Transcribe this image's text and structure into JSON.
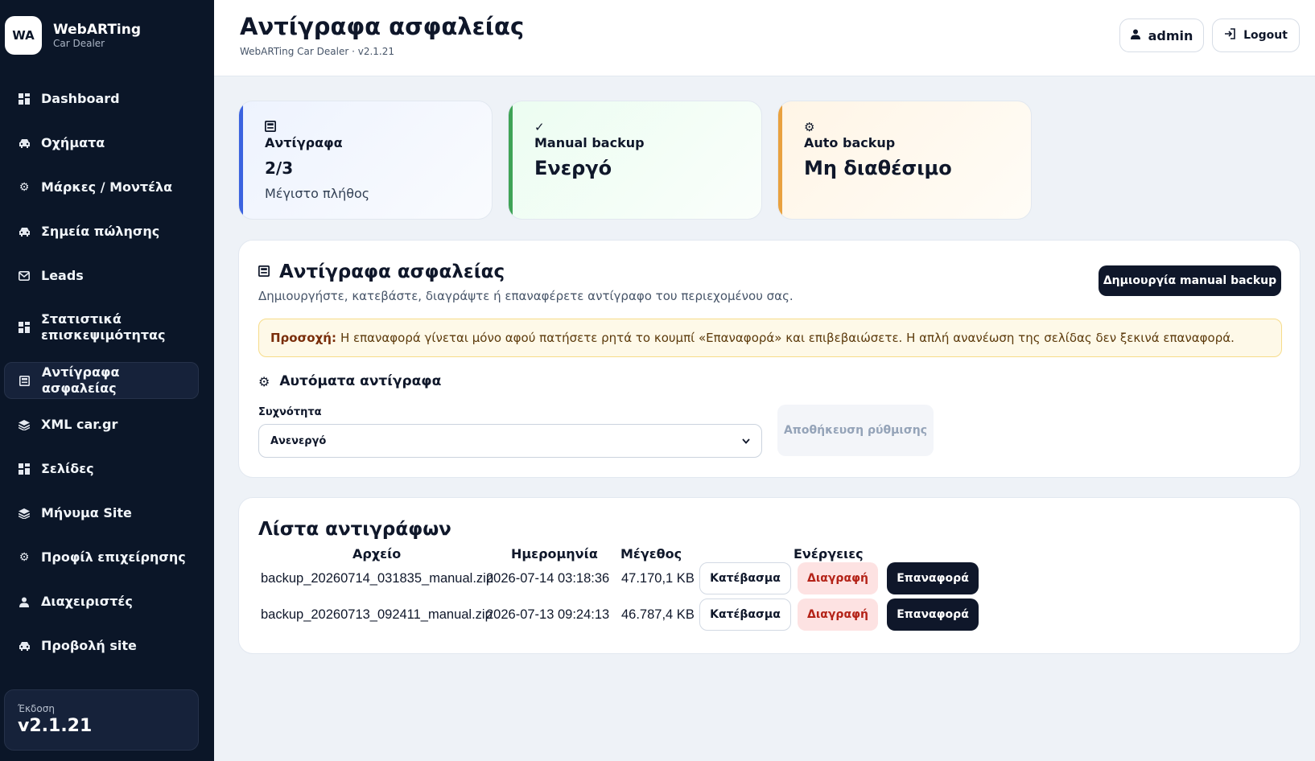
{
  "brand": {
    "logo": "WA",
    "name": "WebARTing",
    "subtitle": "Car Dealer"
  },
  "sidebar": {
    "items": [
      {
        "label": "Dashboard",
        "icon": "grid-icon"
      },
      {
        "label": "Οχήματα",
        "icon": "car-icon"
      },
      {
        "label": "Μάρκες / Μοντέλα",
        "icon": "gear-icon"
      },
      {
        "label": "Σημεία πώλησης",
        "icon": "car-icon"
      },
      {
        "label": "Leads",
        "icon": "mail-icon"
      },
      {
        "label": "Στατιστικά επισκεψιμότητας",
        "icon": "grid-icon"
      },
      {
        "label": "Αντίγραφα ασφαλείας",
        "icon": "floppy-icon",
        "active": true
      },
      {
        "label": "XML car.gr",
        "icon": "layers-icon"
      },
      {
        "label": "Σελίδες",
        "icon": "grid-icon"
      },
      {
        "label": "Μήνυμα Site",
        "icon": "layers-icon"
      },
      {
        "label": "Προφίλ επιχείρησης",
        "icon": "gear-icon"
      },
      {
        "label": "Διαχειριστές",
        "icon": "user-icon"
      },
      {
        "label": "Προβολή site",
        "icon": "car-icon"
      }
    ],
    "version_label": "Έκδοση",
    "version_value": "v2.1.21"
  },
  "header": {
    "title": "Αντίγραφα ασφαλείας",
    "subtitle": "WebARTing Car Dealer · v2.1.21",
    "user_label": "admin",
    "logout_label": "Logout"
  },
  "stats": {
    "copies": {
      "label": "Αντίγραφα",
      "value": "2/3",
      "hint": "Μέγιστο πλήθος",
      "icon": "floppy-icon"
    },
    "manual": {
      "label": "Manual backup",
      "value": "Ενεργό",
      "icon": "check-icon"
    },
    "auto": {
      "label": "Auto backup",
      "value": "Μη διαθέσιμο",
      "icon": "gear-icon"
    }
  },
  "backups": {
    "title": "Αντίγραφα ασφαλείας",
    "subtitle": "Δημιουργήστε, κατεβάστε, διαγράψτε ή επαναφέρετε αντίγραφο του περιεχομένου σας.",
    "create_button": "Δημιουργία manual backup",
    "alert_strong": "Προσοχή:",
    "alert_text": "Η επαναφορά γίνεται μόνο αφού πατήσετε ρητά το κουμπί «Επαναφορά» και επιβεβαιώσετε. Η απλή ανανέωση της σελίδας δεν ξεκινά επαναφορά.",
    "auto_title": "Αυτόματα αντίγραφα",
    "frequency_label": "Συχνότητα",
    "frequency_value": "Ανενεργό",
    "save_button": "Αποθήκευση ρύθμισης"
  },
  "list": {
    "title": "Λίστα αντιγράφων",
    "columns": [
      "Αρχείο",
      "Ημερομηνία",
      "Μέγεθος",
      "Ενέργειες"
    ],
    "rows": [
      {
        "file": "backup_20260714_031835_manual.zip",
        "date": "2026-07-14 03:18:36",
        "size": "47.170,1 KB"
      },
      {
        "file": "backup_20260713_092411_manual.zip",
        "date": "2026-07-13 09:24:13",
        "size": "46.787,4 KB"
      }
    ],
    "download_label": "Κατέβασμα",
    "delete_label": "Διαγραφή",
    "restore_label": "Επαναφορά"
  }
}
